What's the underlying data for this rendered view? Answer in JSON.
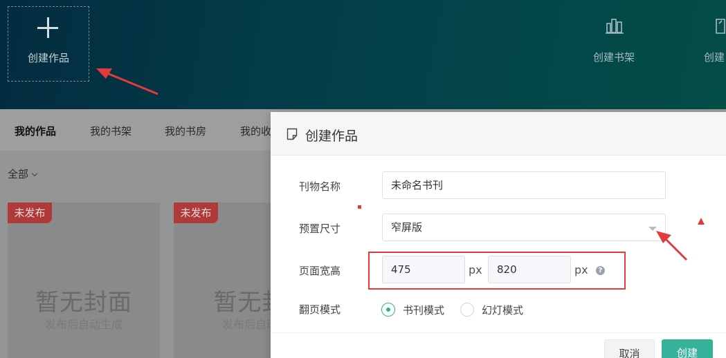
{
  "header": {
    "create_work_label": "创建作品",
    "actions": [
      {
        "label": "创建书架",
        "icon": "bookshelf-icon"
      },
      {
        "label": "创建",
        "icon": "create-icon"
      }
    ]
  },
  "tabs": [
    {
      "label": "我的作品",
      "active": true
    },
    {
      "label": "我的书架",
      "active": false
    },
    {
      "label": "我的书房",
      "active": false
    },
    {
      "label": "我的收",
      "active": false
    }
  ],
  "filter": {
    "label": "全部"
  },
  "cards": [
    {
      "badge": "未发布",
      "cover_text": "暂无封面",
      "cover_sub": "发布后自动生成"
    },
    {
      "badge": "未发布",
      "cover_text": "暂无封",
      "cover_sub": "发布后自动"
    }
  ],
  "dialog": {
    "title": "创建作品",
    "fields": {
      "name_label": "刊物名称",
      "name_value": "未命名书刊",
      "size_label": "预置尺寸",
      "size_value": "窄屏版",
      "page_label": "页面宽高",
      "width_value": "475",
      "height_value": "820",
      "unit": "px",
      "help": "?",
      "mode_label": "翻页模式",
      "modes": [
        {
          "label": "书刊模式",
          "checked": true
        },
        {
          "label": "幻灯模式",
          "checked": false
        }
      ]
    },
    "buttons": {
      "cancel": "取消",
      "create": "创建"
    }
  },
  "colors": {
    "header_bg": "#033f4a",
    "accent": "#34b39a",
    "annotation": "#e23b3b",
    "badge": "#b03a3a"
  }
}
